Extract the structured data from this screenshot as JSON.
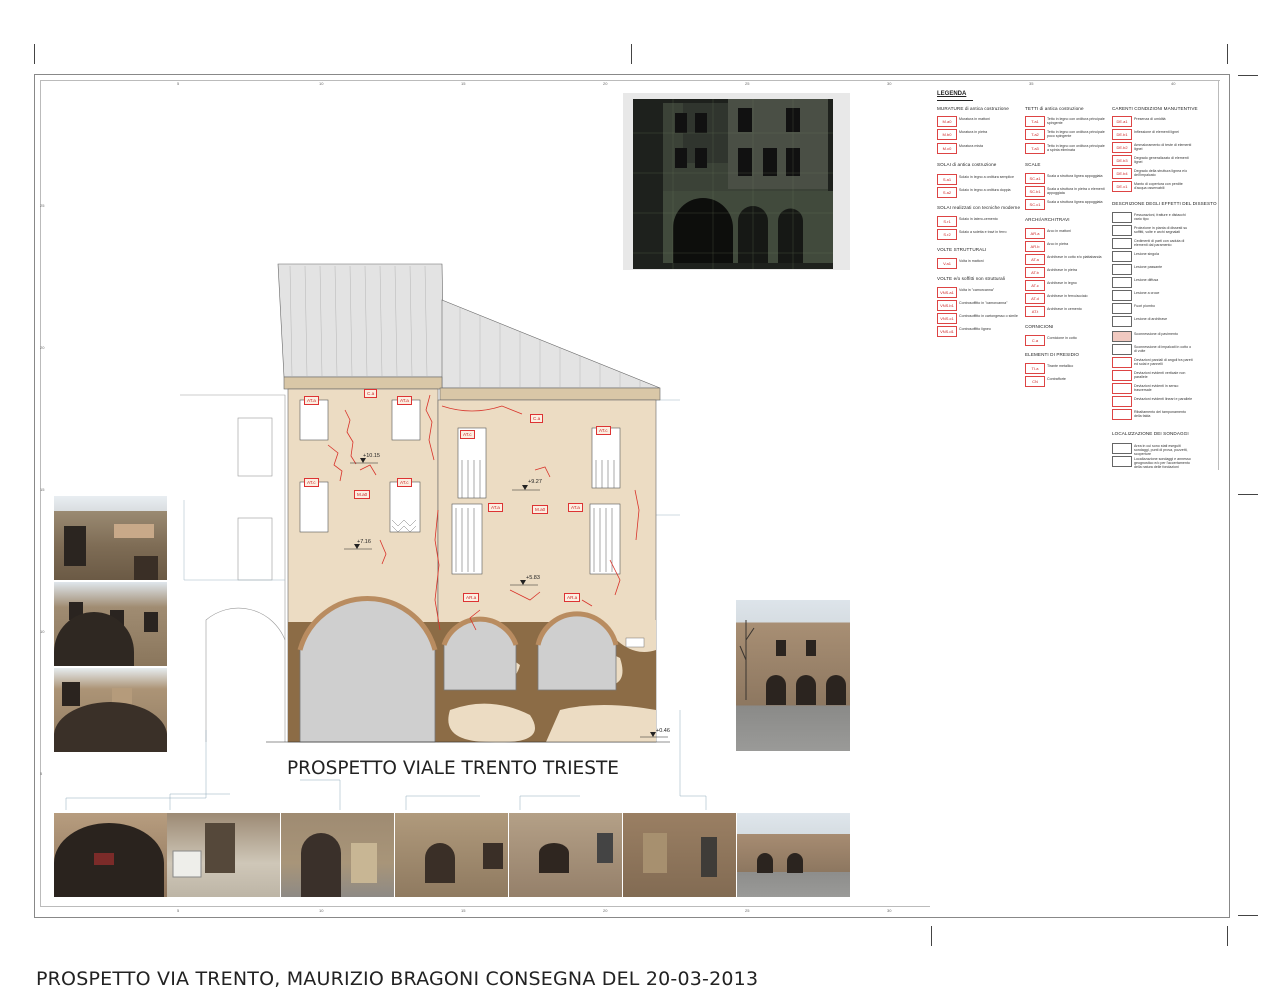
{
  "sheet": {
    "bottom_title": "PROSPETTO VIA TRENTO, MAURIZIO BRAGONI CONSEGNA DEL 20-03-2013",
    "elevation_title": "PROSPETTO VIALE TRENTO TRIESTE"
  },
  "ruler": {
    "top": [
      "5",
      "10",
      "15",
      "20",
      "25",
      "30",
      "35",
      "40"
    ],
    "bottom": [
      "5",
      "10",
      "15",
      "20",
      "25",
      "30"
    ],
    "left": [
      "25",
      "20",
      "15",
      "10",
      "5"
    ]
  },
  "elevation": {
    "levels": [
      "+10.15",
      "+7.16",
      "+9.27",
      "+5.83",
      "+0.46"
    ],
    "tags": [
      "C.a",
      "AT.a",
      "AT.a",
      "AT.c",
      "M.a0",
      "AT.c",
      "C.a",
      "AT.c",
      "AT.c",
      "AT.a",
      "M.a0",
      "AT.a",
      "AR.a",
      "AR.a"
    ]
  },
  "legend": {
    "title": "LEGENDA",
    "columns": [
      {
        "groups": [
          {
            "heading": "MURATURE di antica costruzione",
            "items": [
              {
                "code": "M.a0",
                "label": "Muratura in mattoni"
              },
              {
                "code": "M.b0",
                "label": "Muratura in pietra"
              },
              {
                "code": "M.c0",
                "label": "Muratura mista"
              }
            ]
          },
          {
            "heading": "SOLAI di antica costruzione",
            "items": [
              {
                "code": "S.a1",
                "label": "Solaio in legno a orditura semplice"
              },
              {
                "code": "S.a2",
                "label": "Solaio in legno a orditura doppia"
              }
            ]
          },
          {
            "heading": "SOLAI realizzati con tecniche moderne",
            "items": [
              {
                "code": "S.r1",
                "label": "Solaio in latero-cemento"
              },
              {
                "code": "S.r2",
                "label": "Solaio a soletta e travi in ferro"
              }
            ]
          },
          {
            "heading": "VOLTE STRUTTURALI",
            "items": [
              {
                "code": "V.a1",
                "label": "Volta in mattoni"
              }
            ]
          },
          {
            "heading": "VOLTE e/o soffitti non strutturali",
            "items": [
              {
                "code": "VNS.a1",
                "label": "Volta in \"camorcanna\""
              },
              {
                "code": "VNS.b1",
                "label": "Controsoffitto in \"camorcanna\""
              },
              {
                "code": "VNS.c1",
                "label": "Controsoffitto in cartongesso o simile"
              },
              {
                "code": "VNS.d1",
                "label": "Controsoffitto ligneo"
              }
            ]
          }
        ]
      },
      {
        "groups": [
          {
            "heading": "TETTI di antica costruzione",
            "items": [
              {
                "code": "T.a1",
                "label": "Tetto in legno con orditura principale spingente"
              },
              {
                "code": "T.a2",
                "label": "Tetto in legno con orditura principale poco spingente"
              },
              {
                "code": "T.a3",
                "label": "Tetto in legno con orditura principale a spinta eliminata"
              }
            ]
          },
          {
            "heading": "SCALE",
            "items": [
              {
                "code": "SC.a1",
                "label": "Scala a struttura lignea appoggiata"
              },
              {
                "code": "SC.b1",
                "label": "Scala a struttura in pietra o elementi appoggiata"
              },
              {
                "code": "SC.c1",
                "label": "Scala a struttura lignea appoggiata"
              }
            ]
          },
          {
            "heading": "ARCHI/ARCHITRAVI",
            "items": [
              {
                "code": "AR.a",
                "label": "Arco in mattoni"
              },
              {
                "code": "AR.b",
                "label": "Arco in pietra"
              },
              {
                "code": "AT.a",
                "label": "Architrave in cotto e/o piattabanda"
              },
              {
                "code": "AT.b",
                "label": "Architrave in pietra"
              },
              {
                "code": "AT.c",
                "label": "Architrave in legno"
              },
              {
                "code": "AT.d",
                "label": "Architrave in ferro/acciaio"
              },
              {
                "code": "AT.t",
                "label": "Architrave in cemento"
              }
            ]
          },
          {
            "heading": "CORNICIONI",
            "items": [
              {
                "code": "C.a",
                "label": "Cornicione in cotto"
              }
            ]
          },
          {
            "heading": "ELEMENTI DI PRESIDIO",
            "items": [
              {
                "code": "TI.a",
                "label": "Tirante metallico"
              },
              {
                "code": "CN",
                "label": "Contrafforte"
              }
            ]
          }
        ]
      },
      {
        "groups": [
          {
            "heading": "CARENTI CONDIZIONI MANUTENTIVE",
            "items": [
              {
                "code": "DE.a1",
                "label": "Presenza di umidità"
              },
              {
                "code": "DE.b1",
                "label": "Inflessione di elementi lignei"
              },
              {
                "code": "DE.b2",
                "label": "Ammaloramento di teste di elementi lignei"
              },
              {
                "code": "DE.b3",
                "label": "Degrado generalizzato di elementi lignei"
              },
              {
                "code": "DE.b4",
                "label": "Degrado della struttura lignea e/o dell'impalcato"
              },
              {
                "code": "DE.c1",
                "label": "Manto di copertura con perdite d'acqua osservabili"
              }
            ]
          },
          {
            "heading": "DESCRIZIONE DEGLI EFFETTI DEL DISSESTO",
            "items": [
              {
                "code": "",
                "label": "Fessurazioni, fratture e distacchi vario tipo"
              },
              {
                "code": "",
                "label": "Proiezione in pianta di dissesti su soffitti, volte e archi segnalati"
              },
              {
                "code": "",
                "label": "Cedimenti di parti con caduta di elementi dal paramento"
              },
              {
                "code": "",
                "label": "Lesione singola"
              },
              {
                "code": "",
                "label": "Lesione passante"
              },
              {
                "code": "",
                "label": "Lesione diffusa"
              },
              {
                "code": "",
                "label": "Lesione a croce"
              },
              {
                "code": "",
                "label": "Fuori piombo"
              },
              {
                "code": "",
                "label": "Lesione di architrave"
              },
              {
                "code": "",
                "label": "Sconnessione di pavimento"
              },
              {
                "code": "",
                "label": "Sconnessione di impalcati in cotto o di volte"
              },
              {
                "code": "",
                "label": "Deviazioni parziali di angoli tra pareti ed solai e pannelli"
              },
              {
                "code": "",
                "label": "Deviazioni evidenti verticale non parallele"
              },
              {
                "code": "",
                "label": "Deviazioni evidenti in senso trasversale"
              },
              {
                "code": "",
                "label": "Deviazioni evidenti lineari e parallele"
              },
              {
                "code": "",
                "label": "Ribaltamento del tamponamento della falda"
              }
            ]
          },
          {
            "heading": "LOCALIZZAZIONE DEI SONDAGGI",
            "items": [
              {
                "code": "",
                "label": "Area in cui sono stati eseguiti sondaggi, punti di prova, pozzetti, scoperture"
              },
              {
                "code": "",
                "label": "Localizzazione sondaggi e annesso geognostico e/o per l'accertamento della natura delle fondazioni"
              }
            ]
          }
        ]
      }
    ]
  },
  "colors": {
    "brick": "#ecdcc3",
    "ground_damage": "#8a6a44",
    "crack": "#d8332a",
    "arch_fill": "#cfcfcf",
    "roof": "#e4e4e4"
  }
}
